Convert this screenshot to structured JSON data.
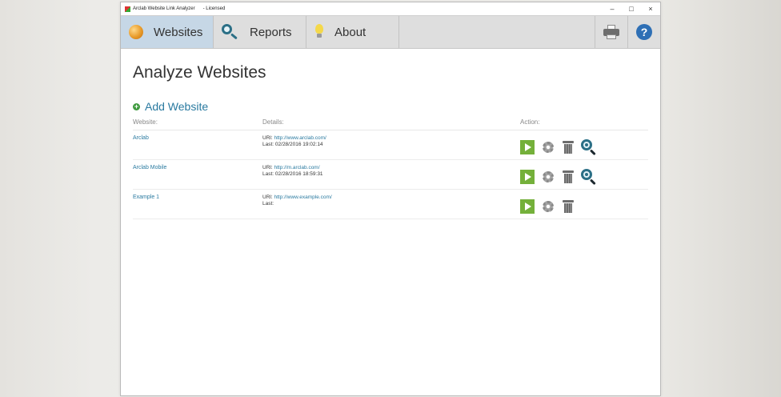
{
  "window": {
    "title": "Arclab Website Link Analyzer",
    "status": "- Licensed"
  },
  "window_controls": {
    "minimize": "–",
    "maximize": "□",
    "close": "×"
  },
  "toolbar": {
    "tabs": [
      {
        "label": "Websites",
        "icon": "globe-icon",
        "active": true
      },
      {
        "label": "Reports",
        "icon": "key-icon",
        "active": false
      },
      {
        "label": "About",
        "icon": "lightbulb-icon",
        "active": false
      }
    ],
    "print_icon": "printer-icon",
    "help_icon": "help-icon",
    "help_glyph": "?"
  },
  "main": {
    "title": "Analyze Websites",
    "add_label": "Add Website",
    "add_glyph": "+",
    "columns": {
      "website": "Website:",
      "details": "Details:",
      "action": "Action:"
    },
    "url_label": "URl:",
    "last_label": "Last:",
    "rows": [
      {
        "name": "Arclab",
        "url": "http://www.arclab.com/",
        "last": "02/28/2016 19:02:14"
      },
      {
        "name": "Arclab Mobile",
        "url": "http://m.arclab.com/",
        "last": "02/28/2016 18:59:31"
      },
      {
        "name": "Example 1",
        "url": "http://www.example.com/",
        "last": ""
      }
    ]
  },
  "colors": {
    "accent": "#2a7aa0",
    "active_tab": "#c6d7e6",
    "play": "#74b03a"
  }
}
